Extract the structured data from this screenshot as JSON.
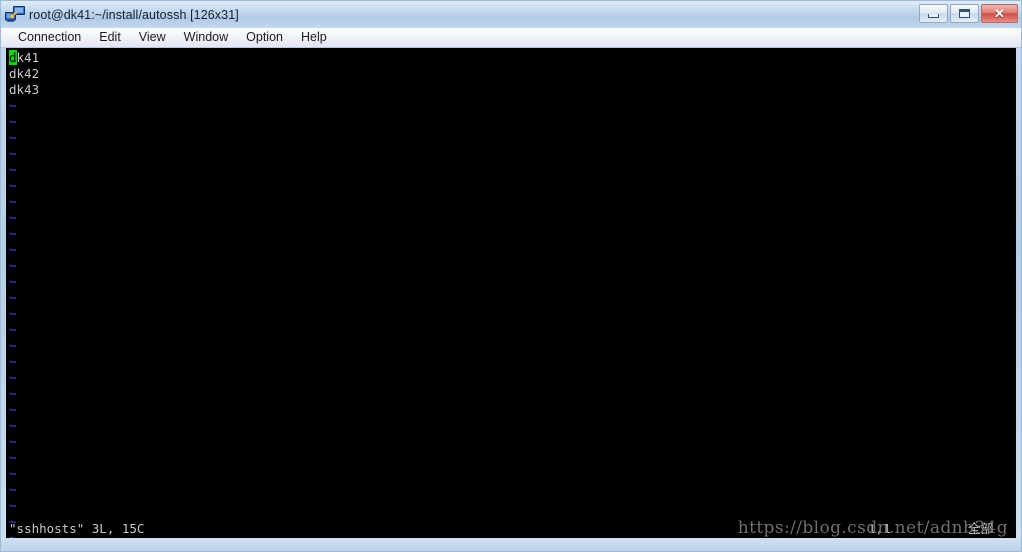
{
  "window": {
    "title": "root@dk41:~/install/autossh [126x31]",
    "icon": "network-terminal-icon",
    "controls": {
      "minimize_label": "–",
      "maximize_label": "□",
      "close_label": "✕"
    }
  },
  "menubar": {
    "items": [
      {
        "label": "Connection",
        "name": "menu-connection"
      },
      {
        "label": "Edit",
        "name": "menu-edit"
      },
      {
        "label": "View",
        "name": "menu-view"
      },
      {
        "label": "Window",
        "name": "menu-window"
      },
      {
        "label": "Option",
        "name": "menu-option"
      },
      {
        "label": "Help",
        "name": "menu-help"
      }
    ]
  },
  "terminal": {
    "cursor": {
      "char": "d",
      "line": 1,
      "column": 1
    },
    "lines": [
      {
        "text": "dk41",
        "type": "text",
        "cursor": true
      },
      {
        "text": "dk42",
        "type": "text",
        "cursor": false
      },
      {
        "text": "dk43",
        "type": "text",
        "cursor": false
      }
    ],
    "tilde_char": "~",
    "tilde_count": 28,
    "status_message": "\"sshhosts\" 3L, 15C",
    "ruler_position": "1,1",
    "ruler_scroll": "全部",
    "colors": {
      "background": "#000000",
      "foreground": "#c8c8c8",
      "tilde": "#4a4aee",
      "cursor_background": "#00d500",
      "cursor_foreground": "#000000"
    }
  },
  "watermark": {
    "text": "https://blog.csdn.net/adnb34g"
  }
}
